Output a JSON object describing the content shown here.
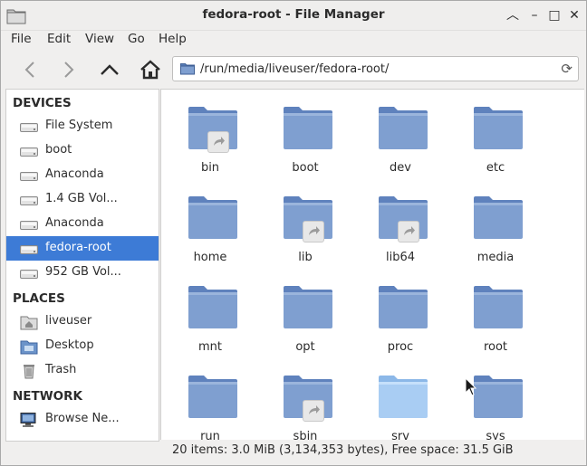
{
  "window": {
    "title": "fedora-root - File Manager",
    "controls": {
      "shade": "︿",
      "minimize": "–",
      "maximize": "□",
      "close": "✕"
    }
  },
  "menubar": [
    "File",
    "Edit",
    "View",
    "Go",
    "Help"
  ],
  "toolbar": {
    "back": "back-icon",
    "forward": "forward-icon",
    "up": "up-icon",
    "home": "home-icon"
  },
  "location": {
    "path": "/run/media/liveuser/fedora-root/"
  },
  "sidebar": {
    "devices_header": "DEVICES",
    "devices": [
      {
        "label": "File System",
        "icon": "drive-icon"
      },
      {
        "label": "boot",
        "icon": "drive-icon"
      },
      {
        "label": "Anaconda",
        "icon": "drive-icon"
      },
      {
        "label": "1.4 GB Vol...",
        "icon": "drive-icon"
      },
      {
        "label": "Anaconda",
        "icon": "drive-icon"
      },
      {
        "label": "fedora-root",
        "icon": "drive-icon",
        "selected": true
      },
      {
        "label": "952 GB Vol...",
        "icon": "drive-icon"
      }
    ],
    "places_header": "PLACES",
    "places": [
      {
        "label": "liveuser",
        "icon": "home-folder-icon"
      },
      {
        "label": "Desktop",
        "icon": "desktop-icon"
      },
      {
        "label": "Trash",
        "icon": "trash-icon"
      }
    ],
    "network_header": "NETWORK",
    "network": [
      {
        "label": "Browse Ne...",
        "icon": "network-icon"
      }
    ]
  },
  "files": [
    {
      "name": "bin",
      "symlink": true
    },
    {
      "name": "boot",
      "symlink": false
    },
    {
      "name": "dev",
      "symlink": false
    },
    {
      "name": "etc",
      "symlink": false
    },
    {
      "name": "home",
      "symlink": false
    },
    {
      "name": "lib",
      "symlink": true
    },
    {
      "name": "lib64",
      "symlink": true
    },
    {
      "name": "media",
      "symlink": false
    },
    {
      "name": "mnt",
      "symlink": false
    },
    {
      "name": "opt",
      "symlink": false
    },
    {
      "name": "proc",
      "symlink": false
    },
    {
      "name": "root",
      "symlink": false
    },
    {
      "name": "run",
      "symlink": false
    },
    {
      "name": "sbin",
      "symlink": true
    },
    {
      "name": "srv",
      "symlink": false,
      "light": true
    },
    {
      "name": "sys",
      "symlink": false
    }
  ],
  "status": {
    "text": "20 items: 3.0 MiB (3,134,353 bytes), Free space: 31.5 GiB"
  },
  "colors": {
    "selection": "#3d7bd6",
    "folder": "#7f9fd0",
    "folder_light": "#a9cdf3"
  }
}
